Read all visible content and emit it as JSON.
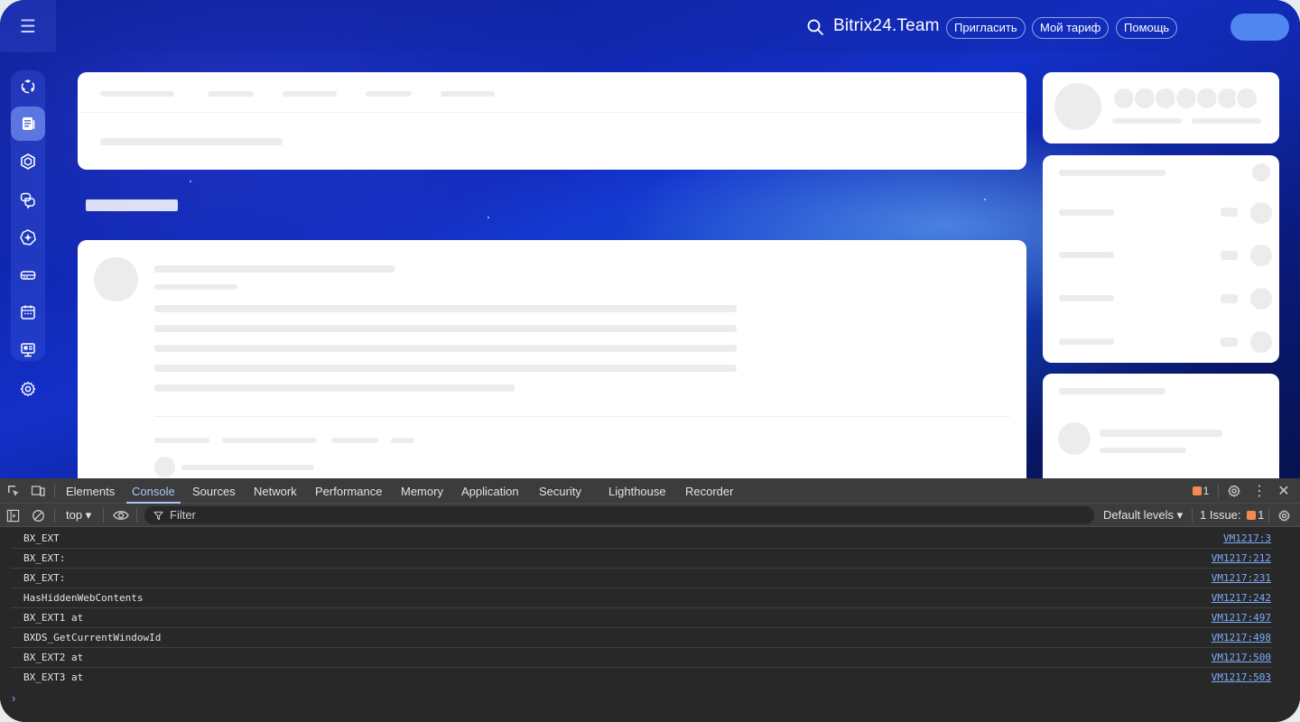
{
  "topbar": {
    "brand": "Bitrix24.Team",
    "invite_label": "Пригласить",
    "plan_label": "Мой тариф",
    "help_label": "Помощь"
  },
  "left_rail": {
    "icons": [
      "activity-stream-icon",
      "feed-icon",
      "hexagon-icon",
      "chat-icon",
      "sparkle-icon",
      "drive-icon",
      "calendar-icon",
      "screen-icon",
      "settings-icon"
    ]
  },
  "devtools": {
    "tabs": [
      "Elements",
      "Console",
      "Sources",
      "Network",
      "Performance",
      "Memory",
      "Application",
      "Security",
      "Lighthouse",
      "Recorder"
    ],
    "active_tab": "Console",
    "issues_badge_count": "1",
    "context": "top ▾",
    "filter_placeholder": "Filter",
    "levels": "Default levels ▾",
    "issues_label": "1 Issue:",
    "issues_count": "1",
    "logs": [
      {
        "message": "BX_EXT",
        "source": "VM1217:3"
      },
      {
        "message": "BX_EXT:",
        "source": "VM1217:212"
      },
      {
        "message": "BX_EXT:",
        "source": "VM1217:231"
      },
      {
        "message": "HasHiddenWebContents",
        "source": "VM1217:242"
      },
      {
        "message": "BX_EXT1 at",
        "source": "VM1217:497"
      },
      {
        "message": "BXDS_GetCurrentWindowId",
        "source": "VM1217:498"
      },
      {
        "message": "BX_EXT2 at",
        "source": "VM1217:500"
      },
      {
        "message": "BX_EXT3 at",
        "source": "VM1217:503"
      }
    ],
    "prompt": "›"
  },
  "colors": {
    "accent": "#a8c7fa",
    "link": "#7cacf8",
    "warning": "#f28b54",
    "avatar": "#4f86f0"
  }
}
